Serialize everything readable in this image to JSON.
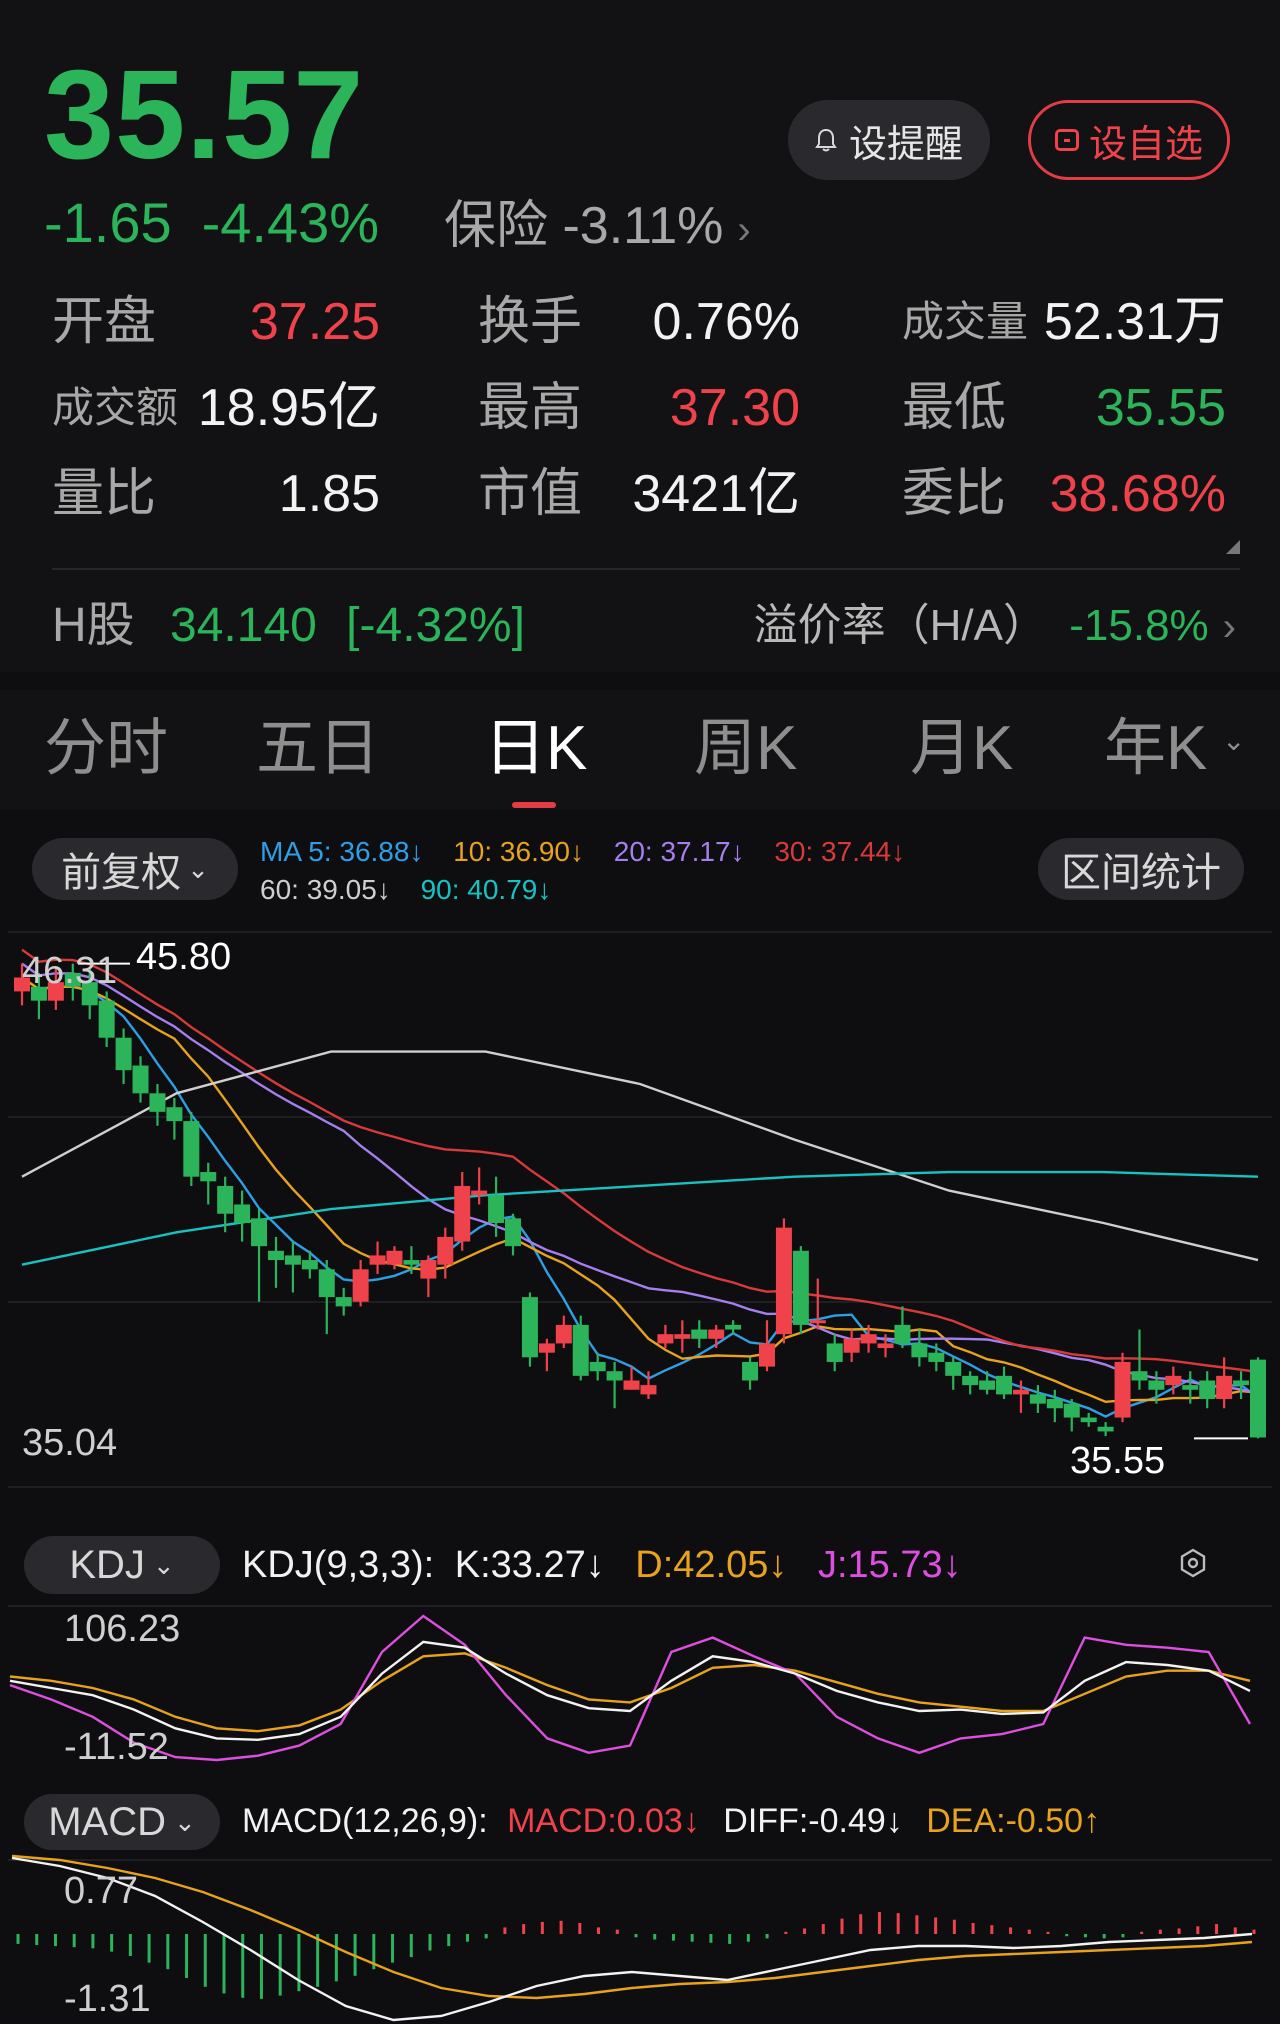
{
  "quote": {
    "price": "35.57",
    "change": "-1.65",
    "change_pct": "-4.43%",
    "sector_name": "保险",
    "sector_change": "-3.11%",
    "alert_label": "设提醒",
    "watch_label": "设自选"
  },
  "stats": [
    [
      {
        "label": "开盘",
        "value": "37.25",
        "color": "red"
      },
      {
        "label": "换手",
        "value": "0.76%",
        "color": "white"
      },
      {
        "label": "成交量",
        "value": "52.31万",
        "color": "white"
      }
    ],
    [
      {
        "label": "成交额",
        "value": "18.95亿",
        "color": "white"
      },
      {
        "label": "最高",
        "value": "37.30",
        "color": "red"
      },
      {
        "label": "最低",
        "value": "35.55",
        "color": "green"
      }
    ],
    [
      {
        "label": "量比",
        "value": "1.85",
        "color": "white"
      },
      {
        "label": "市值",
        "value": "3421亿",
        "color": "white"
      },
      {
        "label": "委比",
        "value": "38.68%",
        "color": "red"
      }
    ]
  ],
  "h_share": {
    "label": "H股",
    "price": "34.140",
    "change": "[-4.32%]",
    "premium_label": "溢价率（H/A）",
    "premium_value": "-15.8%"
  },
  "tabs": [
    "分时",
    "五日",
    "日K",
    "周K",
    "月K",
    "年K"
  ],
  "active_tab": 2,
  "chart": {
    "adjust_label": "前复权",
    "range_stats_label": "区间统计",
    "ma": [
      {
        "label": "MA 5: 36.88↓",
        "color": "#2e9fe6"
      },
      {
        "label": "10: 36.90↓",
        "color": "#e8a21c"
      },
      {
        "label": "20: 37.17↓",
        "color": "#a67ef0"
      },
      {
        "label": "30: 37.44↓",
        "color": "#d83a3a"
      },
      {
        "label": "60: 39.05↓",
        "color": "#cfcfcf"
      },
      {
        "label": "90: 40.79↓",
        "color": "#18c2c2"
      }
    ],
    "y_top": "46.31",
    "y_bottom": "35.04",
    "high_marker": "45.80",
    "low_marker": "35.55"
  },
  "kdj": {
    "selector": "KDJ",
    "params": "KDJ(9,3,3):",
    "k": "K:33.27↓",
    "d": "D:42.05↓",
    "j": "J:15.73↓",
    "y_top": "106.23",
    "y_bottom": "-11.52"
  },
  "macd": {
    "selector": "MACD",
    "params": "MACD(12,26,9):",
    "macd": "MACD:0.03↓",
    "diff": "DIFF:-0.49↓",
    "dea": "DEA:-0.50↑",
    "y_top": "0.77",
    "y_bottom": "-1.31"
  },
  "colors": {
    "up": "#f0424a",
    "down": "#2bb45a",
    "accent": "#e23c44"
  },
  "chart_data": {
    "type": "candlestick",
    "y_range": [
      35.04,
      46.31
    ],
    "candles": [
      [
        45.2,
        45.5,
        44.9,
        45.8
      ],
      [
        45.3,
        45.0,
        44.6,
        45.6
      ],
      [
        45.0,
        45.4,
        44.8,
        45.7
      ],
      [
        45.6,
        45.3,
        45.0,
        45.8
      ],
      [
        45.4,
        44.9,
        44.6,
        45.7
      ],
      [
        45.0,
        44.2,
        44.0,
        45.2
      ],
      [
        44.2,
        43.5,
        43.2,
        44.4
      ],
      [
        43.6,
        43.0,
        42.8,
        43.8
      ],
      [
        43.0,
        42.6,
        42.3,
        43.2
      ],
      [
        42.7,
        42.4,
        42.0,
        42.9
      ],
      [
        42.4,
        41.2,
        41.0,
        42.6
      ],
      [
        41.3,
        41.1,
        40.6,
        41.5
      ],
      [
        41.0,
        40.4,
        40.0,
        41.2
      ],
      [
        40.6,
        40.2,
        39.8,
        40.9
      ],
      [
        40.3,
        39.7,
        38.5,
        40.5
      ],
      [
        39.6,
        39.4,
        38.8,
        39.9
      ],
      [
        39.5,
        39.3,
        38.7,
        39.8
      ],
      [
        39.4,
        39.2,
        39.0,
        39.6
      ],
      [
        39.2,
        38.6,
        37.8,
        39.4
      ],
      [
        38.6,
        38.4,
        38.2,
        38.8
      ],
      [
        38.5,
        39.2,
        38.4,
        39.4
      ],
      [
        39.3,
        39.5,
        39.1,
        39.8
      ],
      [
        39.3,
        39.6,
        39.2,
        39.7
      ],
      [
        39.4,
        39.3,
        39.1,
        39.7
      ],
      [
        39.0,
        39.4,
        38.6,
        39.5
      ],
      [
        39.3,
        39.9,
        39.0,
        40.1
      ],
      [
        39.8,
        41.0,
        39.6,
        41.3
      ],
      [
        40.8,
        40.9,
        40.6,
        41.4
      ],
      [
        40.8,
        40.2,
        39.9,
        41.2
      ],
      [
        40.3,
        39.7,
        39.5,
        40.4
      ],
      [
        38.6,
        37.3,
        37.1,
        38.7
      ],
      [
        37.4,
        37.6,
        37.0,
        37.7
      ],
      [
        37.6,
        38.0,
        37.5,
        38.2
      ],
      [
        38.0,
        36.9,
        36.8,
        38.2
      ],
      [
        37.2,
        37.0,
        36.8,
        37.4
      ],
      [
        37.0,
        36.8,
        36.2,
        37.2
      ],
      [
        36.6,
        36.8,
        36.6,
        37.1
      ],
      [
        36.5,
        36.7,
        36.4,
        37.0
      ],
      [
        37.6,
        37.8,
        37.5,
        38.0
      ],
      [
        37.7,
        37.8,
        37.4,
        38.1
      ],
      [
        37.9,
        37.7,
        37.5,
        38.1
      ],
      [
        37.7,
        37.9,
        37.5,
        38.0
      ],
      [
        38.0,
        37.9,
        37.8,
        38.1
      ],
      [
        37.2,
        36.8,
        36.6,
        37.3
      ],
      [
        37.1,
        37.6,
        37.0,
        38.1
      ],
      [
        37.8,
        40.1,
        37.6,
        40.3
      ],
      [
        39.6,
        38.0,
        37.8,
        39.7
      ],
      [
        38.1,
        38.1,
        37.9,
        39.0
      ],
      [
        37.6,
        37.2,
        37.0,
        37.8
      ],
      [
        37.4,
        37.7,
        37.2,
        37.9
      ],
      [
        37.6,
        37.8,
        37.4,
        38.0
      ],
      [
        37.5,
        37.6,
        37.3,
        37.8
      ],
      [
        38.0,
        37.6,
        37.5,
        38.4
      ],
      [
        37.6,
        37.3,
        37.1,
        37.9
      ],
      [
        37.4,
        37.2,
        37.0,
        37.6
      ],
      [
        37.2,
        36.9,
        36.6,
        37.3
      ],
      [
        36.9,
        36.7,
        36.5,
        37.0
      ],
      [
        36.8,
        36.6,
        36.5,
        37.0
      ],
      [
        36.9,
        36.5,
        36.4,
        37.1
      ],
      [
        36.5,
        36.6,
        36.1,
        36.8
      ],
      [
        36.5,
        36.3,
        36.1,
        36.7
      ],
      [
        36.4,
        36.2,
        35.9,
        36.6
      ],
      [
        36.3,
        36.0,
        35.7,
        36.4
      ],
      [
        36.0,
        35.9,
        35.8,
        36.1
      ],
      [
        35.8,
        35.7,
        35.6,
        35.9
      ],
      [
        36.0,
        37.2,
        35.9,
        37.4
      ],
      [
        37.0,
        36.8,
        36.6,
        37.9
      ],
      [
        36.8,
        36.6,
        36.3,
        37.0
      ],
      [
        36.7,
        36.9,
        36.5,
        37.1
      ],
      [
        36.7,
        36.6,
        36.3,
        37.0
      ],
      [
        36.8,
        36.4,
        36.2,
        37.0
      ],
      [
        36.4,
        36.9,
        36.2,
        37.3
      ],
      [
        36.8,
        36.7,
        36.4,
        37.0
      ],
      [
        37.25,
        35.57,
        35.55,
        37.3
      ]
    ]
  }
}
